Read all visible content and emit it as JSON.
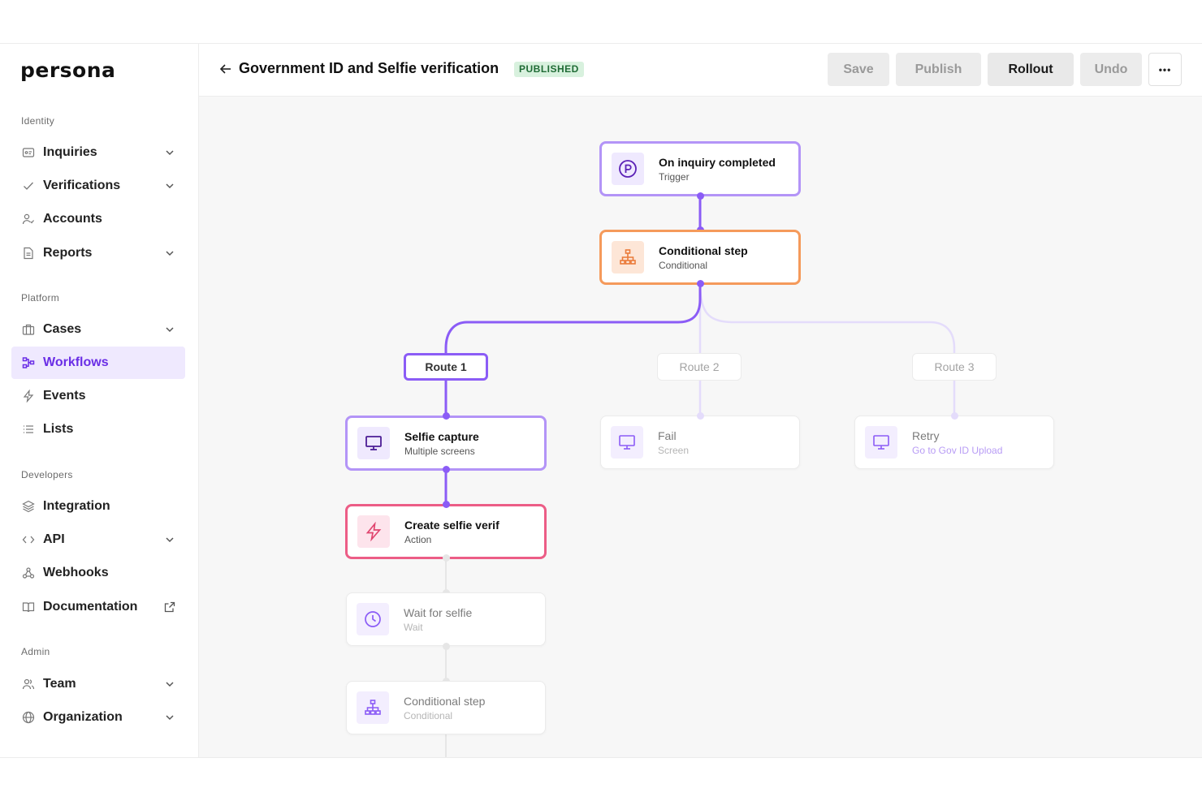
{
  "brand": {
    "name": "persona"
  },
  "sidebar": {
    "sections": [
      {
        "label": "Identity"
      },
      {
        "label": "Platform"
      },
      {
        "label": "Developers"
      },
      {
        "label": "Admin"
      }
    ],
    "items": [
      {
        "label": "Inquiries",
        "icon": "id-card-icon"
      },
      {
        "label": "Verifications",
        "icon": "check-icon"
      },
      {
        "label": "Accounts",
        "icon": "user-check-icon"
      },
      {
        "label": "Reports",
        "icon": "document-icon"
      },
      {
        "label": "Cases",
        "icon": "briefcase-icon"
      },
      {
        "label": "Workflows",
        "icon": "workflow-icon",
        "active": true
      },
      {
        "label": "Events",
        "icon": "lightning-icon"
      },
      {
        "label": "Lists",
        "icon": "list-icon"
      },
      {
        "label": "Integration",
        "icon": "layers-icon"
      },
      {
        "label": "API",
        "icon": "code-icon"
      },
      {
        "label": "Webhooks",
        "icon": "webhook-icon"
      },
      {
        "label": "Documentation",
        "icon": "book-icon"
      },
      {
        "label": "Team",
        "icon": "team-icon"
      },
      {
        "label": "Organization",
        "icon": "globe-icon"
      }
    ]
  },
  "header": {
    "title": "Government ID and Selfie verification",
    "status": "PUBLISHED",
    "buttons": {
      "save": "Save",
      "publish": "Publish",
      "rollout": "Rollout",
      "undo": "Undo",
      "more": "•••"
    }
  },
  "workflow": {
    "trigger": {
      "title": "On inquiry completed",
      "subtitle": "Trigger"
    },
    "conditional": {
      "title": "Conditional step",
      "subtitle": "Conditional"
    },
    "routes": [
      "Route 1",
      "Route 2",
      "Route 3"
    ],
    "route1": [
      {
        "title": "Selfie capture",
        "subtitle": "Multiple screens"
      },
      {
        "title": "Create selfie verif",
        "subtitle": "Action"
      },
      {
        "title": "Wait for selfie",
        "subtitle": "Wait"
      },
      {
        "title": "Conditional step",
        "subtitle": "Conditional"
      }
    ],
    "route2": {
      "title": "Fail",
      "subtitle": "Screen"
    },
    "route3": {
      "title": "Retry",
      "subtitle": "Go to Gov ID Upload"
    }
  },
  "colors": {
    "accent": "#8b5cf6",
    "accent_light": "#e4dcfb",
    "orange": "#f59a5b",
    "pink": "#ec5d86",
    "active_bg": "#efe9fe",
    "published_bg": "#d8f1de"
  }
}
